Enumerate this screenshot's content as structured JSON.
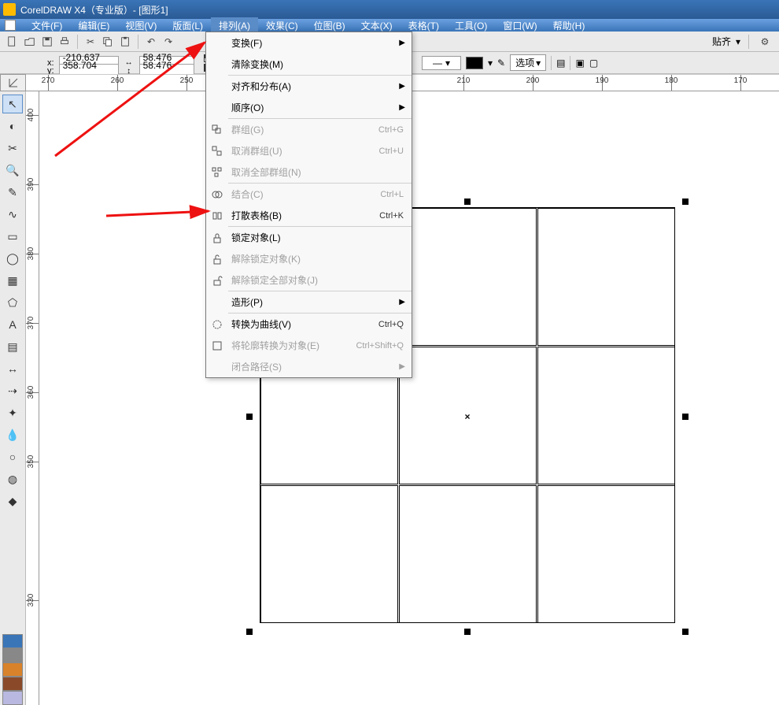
{
  "title": "CorelDRAW X4（专业版）- [图形1]",
  "menubar": [
    "文件(F)",
    "编辑(E)",
    "视图(V)",
    "版面(L)",
    "排列(A)",
    "效果(C)",
    "位图(B)",
    "文本(X)",
    "表格(T)",
    "工具(O)",
    "窗口(W)",
    "帮助(H)"
  ],
  "active_menu_index": 4,
  "toolbar1_right": {
    "snap_label": "贴齐"
  },
  "propbar": {
    "x_label": "x:",
    "x_val": "-210.637 mm",
    "y_label": "y:",
    "y_val": "358.704 mm",
    "w_val": "58.476 mm",
    "h_val": "58.476 mm",
    "rows": "3",
    "cols": "3",
    "options_label": "选项"
  },
  "ruler_h": [
    "270",
    "260",
    "250",
    "210",
    "200",
    "190",
    "180",
    "170"
  ],
  "ruler_h_pos": [
    28,
    116,
    204,
    556,
    644,
    732,
    820,
    908
  ],
  "ruler_v": [
    "400",
    "390",
    "380",
    "370",
    "360",
    "350",
    "330"
  ],
  "ruler_v_pos": [
    30,
    118,
    206,
    294,
    382,
    470,
    646
  ],
  "dropdown": {
    "items": [
      {
        "label": "变换(F)",
        "sub": true
      },
      {
        "label": "清除变换(M)"
      },
      {
        "sep": true
      },
      {
        "label": "对齐和分布(A)",
        "sub": true
      },
      {
        "label": "顺序(O)",
        "sub": true
      },
      {
        "sep": true
      },
      {
        "label": "群组(G)",
        "sc": "Ctrl+G",
        "disabled": true,
        "icon": "group"
      },
      {
        "label": "取消群组(U)",
        "sc": "Ctrl+U",
        "disabled": true,
        "icon": "ungroup"
      },
      {
        "label": "取消全部群组(N)",
        "disabled": true,
        "icon": "ungroup-all"
      },
      {
        "sep": true
      },
      {
        "label": "结合(C)",
        "sc": "Ctrl+L",
        "disabled": true,
        "icon": "combine"
      },
      {
        "label": "打散表格(B)",
        "sc": "Ctrl+K",
        "icon": "break"
      },
      {
        "sep": true
      },
      {
        "label": "锁定对象(L)",
        "icon": "lock"
      },
      {
        "label": "解除锁定对象(K)",
        "disabled": true,
        "icon": "unlock"
      },
      {
        "label": "解除锁定全部对象(J)",
        "disabled": true,
        "icon": "unlock-all"
      },
      {
        "sep": true
      },
      {
        "label": "造形(P)",
        "sub": true
      },
      {
        "sep": true
      },
      {
        "label": "转换为曲线(V)",
        "sc": "Ctrl+Q",
        "icon": "curve"
      },
      {
        "label": "将轮廓转换为对象(E)",
        "sc": "Ctrl+Shift+Q",
        "disabled": true,
        "icon": "outline-obj"
      },
      {
        "label": "闭合路径(S)",
        "disabled": true,
        "sub": true
      }
    ]
  },
  "toolbox_tools": [
    "pick",
    "shape",
    "crop",
    "zoom",
    "freehand",
    "smart",
    "rect",
    "ellipse",
    "graph",
    "polygon",
    "text",
    "table",
    "dims",
    "connector",
    "effects",
    "eyedrop",
    "outline",
    "fill",
    "ifill"
  ],
  "palette": [
    "#3a75b8",
    "#888",
    "#d8822c",
    "#8a4a2a",
    "#b8b8e0"
  ]
}
